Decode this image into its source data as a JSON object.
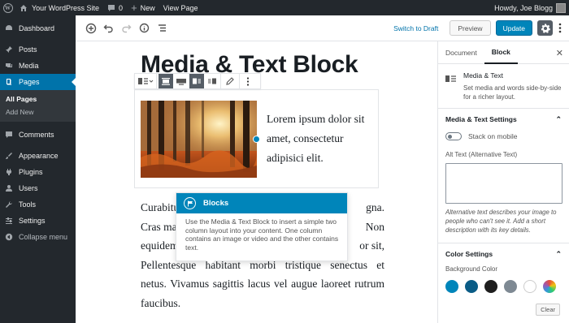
{
  "adminbar": {
    "site_name": "Your WordPress Site",
    "comments_count": "0",
    "new_label": "New",
    "view_page_label": "View Page",
    "howdy": "Howdy, Joe Blogg"
  },
  "sidebar": {
    "items": [
      {
        "label": "Dashboard",
        "icon": "dashboard-icon"
      },
      {
        "label": "Posts",
        "icon": "pin-icon"
      },
      {
        "label": "Media",
        "icon": "media-icon"
      },
      {
        "label": "Pages",
        "icon": "pages-icon",
        "active": true
      },
      {
        "label": "Comments",
        "icon": "comment-icon"
      },
      {
        "label": "Appearance",
        "icon": "brush-icon"
      },
      {
        "label": "Plugins",
        "icon": "plug-icon"
      },
      {
        "label": "Users",
        "icon": "user-icon"
      },
      {
        "label": "Tools",
        "icon": "wrench-icon"
      },
      {
        "label": "Settings",
        "icon": "settings-icon"
      },
      {
        "label": "Collapse menu",
        "icon": "collapse-icon"
      }
    ],
    "submenu": [
      "All Pages",
      "Add New"
    ]
  },
  "toolbar": {
    "switch_draft": "Switch to Draft",
    "preview": "Preview",
    "update": "Update"
  },
  "editor": {
    "title": "Media & Text Block",
    "media_text": "Lorem ipsum dolor sit amet, consectetur adipisici elit.",
    "paragraph_lines": [
      "Curabitu",
      "Cras ma",
      "equidem",
      "Pellentesque habitant morbi tristique senectus et",
      "netus. Vivamus sagittis lacus vel augue laoreet rutrum",
      "faucibus."
    ],
    "paragraph_right": [
      "gna.",
      "Non",
      "or sit,"
    ]
  },
  "tip": {
    "title": "Blocks",
    "body": "Use the Media & Text Block to insert a simple two column layout into your content. One column contains an image or video and the other contains text."
  },
  "panel": {
    "tabs": [
      "Document",
      "Block"
    ],
    "active_tab": "Block",
    "block_name": "Media & Text",
    "block_desc": "Set media and words side-by-side for a richer layout.",
    "mt_settings": "Media & Text Settings",
    "stack_mobile": "Stack on mobile",
    "alt_label": "Alt Text (Alternative Text)",
    "alt_help": "Alternative text describes your image to people who can't see it. Add a short description with its key details.",
    "color_settings": "Color Settings",
    "bg_label": "Background Color",
    "swatches": [
      "#0085ba",
      "#0a5c86",
      "#1e1e1e",
      "#7e8993",
      "#ffffff",
      "gradient"
    ],
    "clear": "Clear"
  },
  "colors": {
    "admin_dark": "#23282d",
    "accent": "#0073aa",
    "primary_button": "#0085ba"
  }
}
